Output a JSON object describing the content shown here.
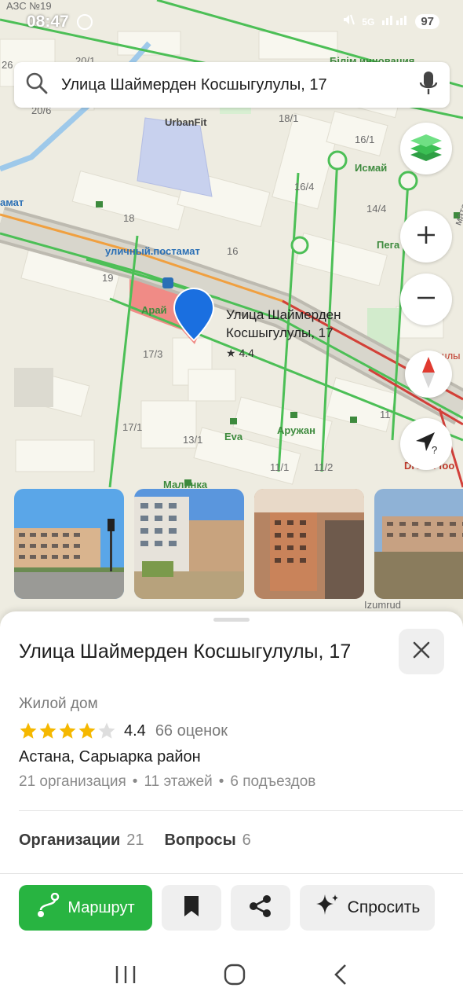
{
  "status_bar": {
    "time": "08:47",
    "top_label": "АЗС №19",
    "network": "5G",
    "battery": "97"
  },
  "search": {
    "query": "Улица Шаймерден Косшыгулулы, 17"
  },
  "map": {
    "labels": {
      "urbanfit": "UrbanFit",
      "n20_6": "20/6",
      "n18_1": "18/1",
      "n16_1": "16/1",
      "ismay": "Исмай",
      "n16_4": "16/4",
      "n14_4": "14/4",
      "n18": "18",
      "postamat_short": "амат",
      "n16": "16",
      "pega": "Пега",
      "postamat": "уличный.постамат",
      "n19": "19",
      "arai": "Арай",
      "place_line1": "Улица Шаймерден",
      "place_line2": "Косшыгулулы, 17",
      "place_rating": "★ 4.4",
      "shash": "Шашлы",
      "n17_3": "17/3",
      "n11": "11",
      "n17_1": "17/1",
      "n13_1": "13/1",
      "eva": "Eva",
      "aruzhan": "Аружан",
      "n11_1": "11/1",
      "n11_2": "11/2",
      "malinka": "Малинка",
      "dream_food": "Dream foo",
      "izumrud": "Izumrud",
      "n20_1": "20/1",
      "n26": "26",
      "bilim": "Білім инновация",
      "mata": "мата"
    }
  },
  "place": {
    "title": "Улица Шаймерден Косшыгулулы, 17",
    "type": "Жилой дом",
    "rating": "4.4",
    "rating_count": "66 оценок",
    "stars_filled": 4,
    "address": "Астана, Сарыарка район",
    "meta": [
      "21 организация",
      "11 этажей",
      "6 подъездов"
    ],
    "tabs": [
      {
        "label": "Организации",
        "count": "21"
      },
      {
        "label": "Вопросы",
        "count": "6"
      }
    ]
  },
  "actions": {
    "route": "Маршрут",
    "ask": "Спросить"
  },
  "icons": {
    "search": "search-icon",
    "mic": "microphone-icon",
    "layers": "layers-icon",
    "zoom_in": "plus-icon",
    "zoom_out": "minus-icon",
    "compass": "compass-icon",
    "location": "navigation-arrow-icon",
    "close": "close-icon",
    "bookmark": "bookmark-icon",
    "share": "share-icon",
    "sparkle": "sparkle-icon"
  },
  "colors": {
    "accent_green": "#28b441",
    "star_yellow": "#f5b800",
    "pin_blue": "#1a6fe0"
  }
}
